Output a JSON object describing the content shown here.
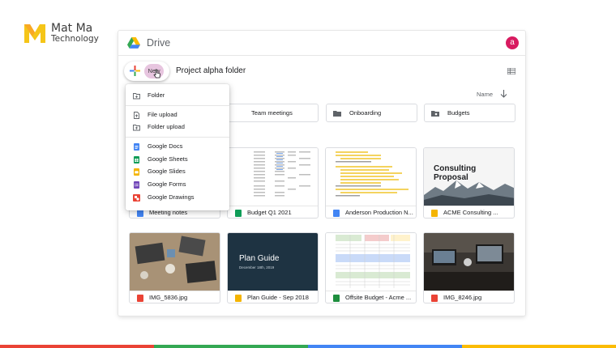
{
  "brand": {
    "name": "Mat Ma",
    "sub": "Technology"
  },
  "drive": {
    "title": "Drive",
    "avatar_letter": "a",
    "new_label": "New",
    "folder_title": "Project alpha folder",
    "sort_label": "Name"
  },
  "folders": [
    {
      "label": "Team meetings",
      "icon": "folder-icon"
    },
    {
      "label": "Onboarding",
      "icon": "folder-icon"
    },
    {
      "label": "Budgets",
      "icon": "shared-folder-icon"
    }
  ],
  "files_row1": [
    {
      "label": "Meeting notes",
      "icon": "docs-icon",
      "color": "#4285f4"
    },
    {
      "label": "Budget Q1 2021",
      "icon": "sheets-icon",
      "color": "#0f9d58"
    },
    {
      "label": "Anderson Production N...",
      "icon": "docs-icon",
      "color": "#4285f4"
    },
    {
      "label": "ACME Consulting ...",
      "icon": "slides-icon",
      "color": "#f4b400"
    }
  ],
  "files_row2": [
    {
      "label": "IMG_5836.jpg",
      "icon": "image-icon",
      "color": "#ea4335"
    },
    {
      "label": "Plan Guide - Sep 2018",
      "icon": "slides-icon",
      "color": "#f4b400"
    },
    {
      "label": "Offsite Budget - Acme ...",
      "icon": "excel-icon",
      "color": "#1e8e3e"
    },
    {
      "label": "IMG_8246.jpg",
      "icon": "image-icon",
      "color": "#ea4335"
    }
  ],
  "thumbs": {
    "consulting_title": "Consulting Proposal",
    "plan_title": "Plan Guide",
    "plan_sub": "December 18th, 2019"
  },
  "menu": {
    "folder": "Folder",
    "file_upload": "File upload",
    "folder_upload": "Folder upload",
    "docs": "Google Docs",
    "sheets": "Google Sheets",
    "slides": "Google Slides",
    "forms": "Google Forms",
    "drawings": "Google Drawings"
  },
  "colors": {
    "blue": "#4285f4",
    "red": "#ea4335",
    "yellow": "#fbbc04",
    "green": "#34a853",
    "brand_yellow": "#f5c518"
  }
}
